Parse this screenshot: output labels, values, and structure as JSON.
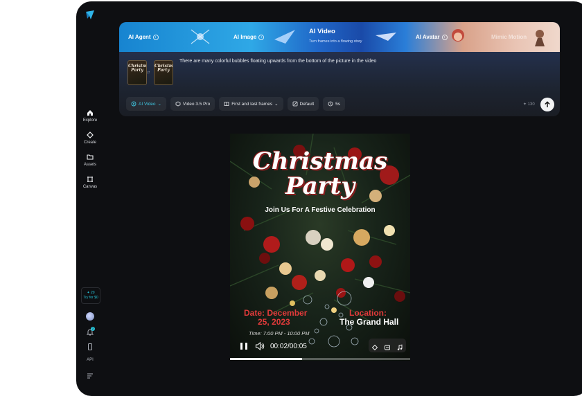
{
  "sidebar": {
    "items": [
      {
        "label": "Explore",
        "icon": "home-icon"
      },
      {
        "label": "Create",
        "icon": "create-icon"
      },
      {
        "label": "Assets",
        "icon": "folder-icon"
      },
      {
        "label": "Canvas",
        "icon": "canvas-icon"
      }
    ],
    "promo": {
      "credits": "20",
      "cta": "Try for $0"
    },
    "notifications": "2",
    "api_label": "API"
  },
  "tabs": [
    {
      "label": "AI Agent"
    },
    {
      "label": "AI Image"
    },
    {
      "label": "AI Video",
      "subtitle": "Turn frames into a flowing story",
      "active": true
    },
    {
      "label": "AI Avatar"
    },
    {
      "label": "Mimic Motion"
    }
  ],
  "prompt": {
    "text": "There are many colorful bubbles floating upwards from the bottom of the picture in the video",
    "thumb_text": "Christmas Party"
  },
  "options": {
    "mode": "AI Video",
    "model": "Video 3.5 Pro",
    "frames": "First and last frames",
    "style": "Default",
    "duration": "5s"
  },
  "credits_cost": "130",
  "poster": {
    "title_line1": "Christmas",
    "title_line2": "Party",
    "subtitle": "Join Us For A Festive Celebration",
    "date_label": "Date: December",
    "date_value": "25, 2023",
    "location_label": "Location:",
    "location_value": "The Grand Hall",
    "time": "Time: 7:00 PM - 10:00 PM"
  },
  "player": {
    "current_time": "00:02",
    "duration": "00:05",
    "time_display": "00:02/00:05",
    "progress": 0.4
  },
  "colors": {
    "accent": "#27c3d8",
    "background": "#0e0f12",
    "poster_red": "#e23a3a"
  }
}
